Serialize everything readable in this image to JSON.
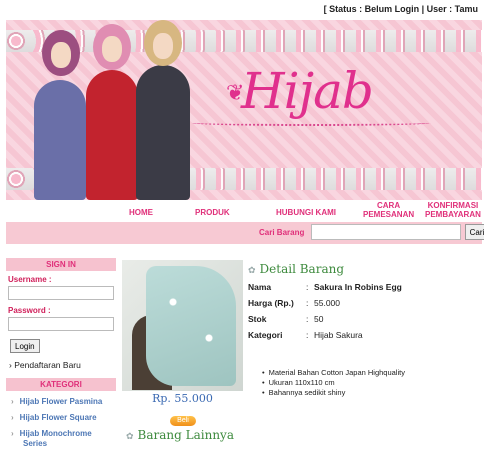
{
  "status": "[ Status : Belum Login | User : Tamu",
  "banner": {
    "logo": "Hijab"
  },
  "nav": {
    "home": "HOME",
    "produk": "PRODUK",
    "hubungi": "HUBUNGI KAMI",
    "cara_1": "CARA",
    "cara_2": "PEMESANAN",
    "konfirmasi_1": "KONFIRMASI",
    "konfirmasi_2": "PEMBAYARAN"
  },
  "search": {
    "label": "Cari Barang",
    "value": "",
    "button": "Cari"
  },
  "sidebar": {
    "signin_title": "SIGN IN",
    "username_label": "Username :",
    "password_label": "Password :",
    "login_button": "Login",
    "register": "Pendaftaran Baru",
    "kategori_title": "KATEGORI",
    "categories": [
      "Hijab Flower Pasmina",
      "Hijab Flower Square",
      "Hijab Monochrome",
      "Series"
    ]
  },
  "product": {
    "price": "Rp. 55.000",
    "buy": "Beli",
    "detail_title": "Detail Barang",
    "related_title": "Barang Lainnya",
    "fields": [
      {
        "key": "Nama",
        "value": "Sakura In Robins Egg"
      },
      {
        "key": "Harga (Rp.)",
        "value": "55.000"
      },
      {
        "key": "Stok",
        "value": "50"
      },
      {
        "key": "Kategori",
        "value": "Hijab Sakura"
      }
    ],
    "features": [
      "Material Bahan Cotton Japan Highquality",
      "Ukuran 110x110 cm",
      "Bahannya sedikit shiny"
    ]
  },
  "colors": {
    "accent": "#e0307a",
    "nav_bg": "#f7c9d3",
    "link": "#4d77b5",
    "heading": "#3d8a3d"
  }
}
